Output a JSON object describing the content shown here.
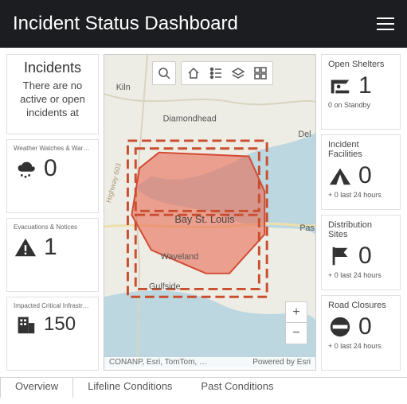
{
  "header": {
    "title": "Incident Status Dashboard"
  },
  "incidents_card": {
    "title": "Incidents",
    "description": "There are no active or open incidents at"
  },
  "left_metrics": {
    "watches": {
      "title": "Weather Watches & Warnings",
      "value": "0"
    },
    "evac": {
      "title": "Evacuations & Notices",
      "value": "1"
    },
    "infra": {
      "title": "Impacted Critical Infrastructure",
      "value": "150"
    }
  },
  "right_metrics": {
    "shelters": {
      "title": "Open Shelters",
      "value": "1",
      "sub": "0 on Standby"
    },
    "facilities": {
      "title": "Incident Facilities",
      "value": "0",
      "sub": "+ 0 last 24 hours"
    },
    "dist": {
      "title": "Distribution Sites",
      "value": "0",
      "sub": "+ 0 last 24 hours"
    },
    "roads": {
      "title": "Road Closures",
      "value": "0",
      "sub": "+ 0 last 24 hours"
    }
  },
  "map": {
    "labels": {
      "kiln": "Kiln",
      "diamondhead": "Diamondhead",
      "del": "Del",
      "bay": "Bay St. Louis",
      "waveland": "Waveland",
      "gulfside": "Gulfside",
      "pas": "Pas",
      "hwy": "Highway 603"
    },
    "attrib_left": "CONANP, Esri, TomTom, …",
    "attrib_right": "Powered by Esri"
  },
  "tabs": {
    "overview": "Overview",
    "lifeline": "Lifeline Conditions",
    "past": "Past Conditions"
  }
}
